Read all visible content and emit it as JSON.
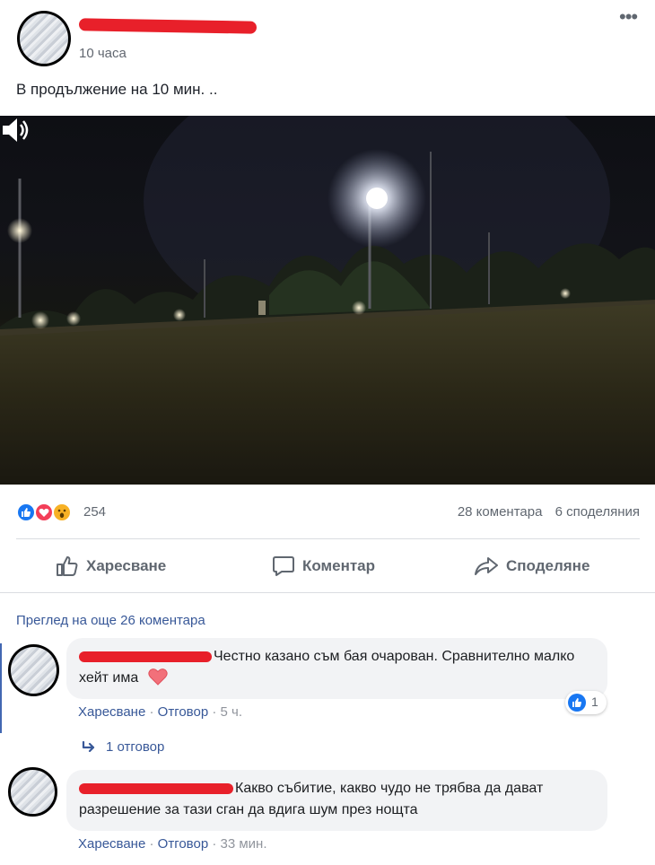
{
  "post": {
    "timestamp": "10 часа",
    "text": "В продължение на 10 мин. ..",
    "more_icon": "ellipsis-icon"
  },
  "video": {
    "scene": "night-field-with-street-lights",
    "volume_icon": "speaker-icon"
  },
  "reactions": {
    "icons": [
      "like-reaction-icon",
      "love-reaction-icon",
      "wow-reaction-icon"
    ],
    "count": "254",
    "comments": "28 коментара",
    "shares": "6 споделяния"
  },
  "actions": {
    "like_label": "Харесване",
    "comment_label": "Коментар",
    "share_label": "Споделяне"
  },
  "comments": {
    "view_more": "Преглед на още 26 коментара",
    "items": [
      {
        "text": "Честно казано съм бая очарован. Сравнително малко хейт има",
        "like_count": "1",
        "like_label": "Харесване",
        "reply_label": "Отговор",
        "time": "5 ч.",
        "replies": "1 отговор"
      },
      {
        "text": "Какво събитие, какво чудо не трябва да дават разрешение за тази сган да вдига шум през нощта",
        "like_label": "Харесване",
        "reply_label": "Отговор",
        "time": "33 мин."
      }
    ]
  },
  "colors": {
    "link": "#385898",
    "like_blue": "#1877f2",
    "love_red": "#f33e58",
    "wow_yellow": "#f7b125",
    "redaction": "#e8202a"
  }
}
